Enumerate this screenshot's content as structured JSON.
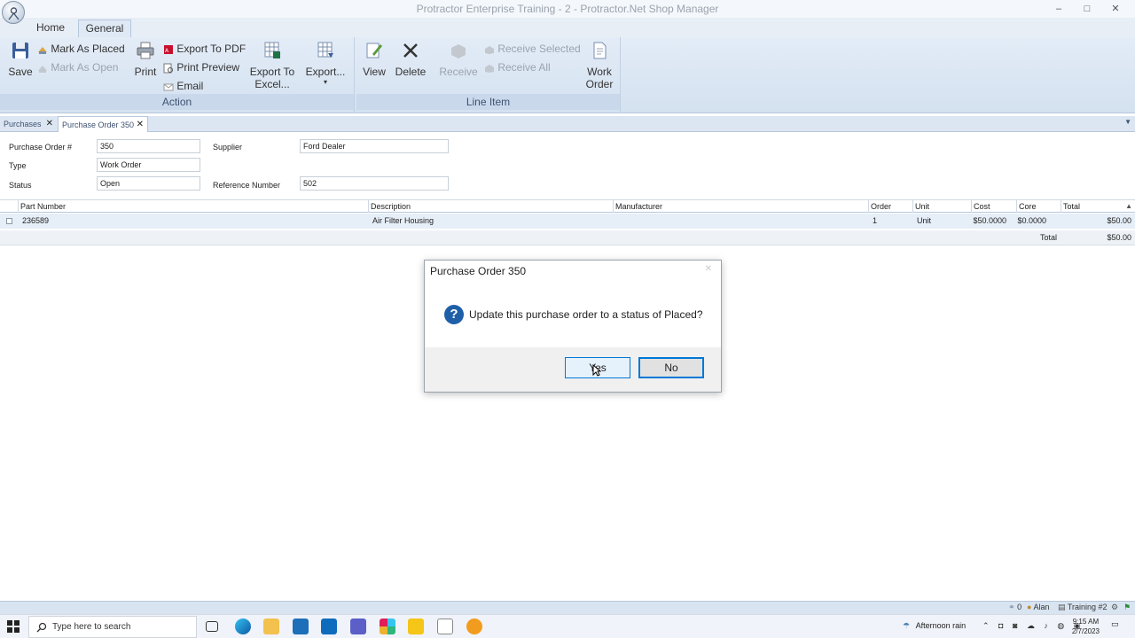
{
  "window": {
    "title": "Protractor Enterprise Training - 2 - Protractor.Net Shop Manager",
    "minimize": "–",
    "maximize": "□",
    "close": "✕"
  },
  "ribbon": {
    "tabs": [
      "Home",
      "General"
    ],
    "action_group": {
      "label": "Action",
      "save": "Save",
      "mark_as_placed": "Mark As Placed",
      "mark_as_open": "Mark As Open",
      "print": "Print",
      "export_pdf": "Export To PDF",
      "print_preview": "Print Preview",
      "email": "Email",
      "export_excel_1": "Export To",
      "export_excel_2": "Excel...",
      "export": "Export...",
      "export_arrow": "▾"
    },
    "line_item_group": {
      "label": "Line Item",
      "view": "View",
      "delete": "Delete",
      "receive": "Receive",
      "receive_selected": "Receive Selected",
      "receive_all": "Receive All",
      "work_order_1": "Work",
      "work_order_2": "Order"
    }
  },
  "doc_tabs": {
    "tabs": [
      "Purchases",
      "Purchase Order 350"
    ],
    "close": "✕",
    "overflow": "▼"
  },
  "form": {
    "po_number_label": "Purchase Order #",
    "po_number": "350",
    "type_label": "Type",
    "type": "Work Order",
    "status_label": "Status",
    "status": "Open",
    "supplier_label": "Supplier",
    "supplier": "Ford Dealer",
    "reference_label": "Reference Number",
    "reference": "502"
  },
  "grid": {
    "columns": [
      "Part Number",
      "Description",
      "Manufacturer",
      "Order",
      "Unit",
      "Cost",
      "Core",
      "Total"
    ],
    "sort_indicator": "▲",
    "rows": [
      {
        "part_number": "236589",
        "description": "Air Filter Housing",
        "manufacturer": "",
        "order": "1",
        "unit": "Unit",
        "cost": "$50.0000",
        "core": "$0.0000",
        "total": "$50.00"
      }
    ],
    "total_label": "Total",
    "total_value": "$50.00"
  },
  "dialog": {
    "title": "Purchase Order 350",
    "close": "✕",
    "icon": "?",
    "message": "Update this purchase order to a status of Placed?",
    "yes": "Yes",
    "no": "No"
  },
  "statusbar": {
    "count": "0",
    "user": "Alan",
    "training": "Training #2"
  },
  "taskbar": {
    "search_placeholder": "Type here to search",
    "weather": "Afternoon rain",
    "time": "9:15 AM",
    "date": "2/7/2023"
  }
}
